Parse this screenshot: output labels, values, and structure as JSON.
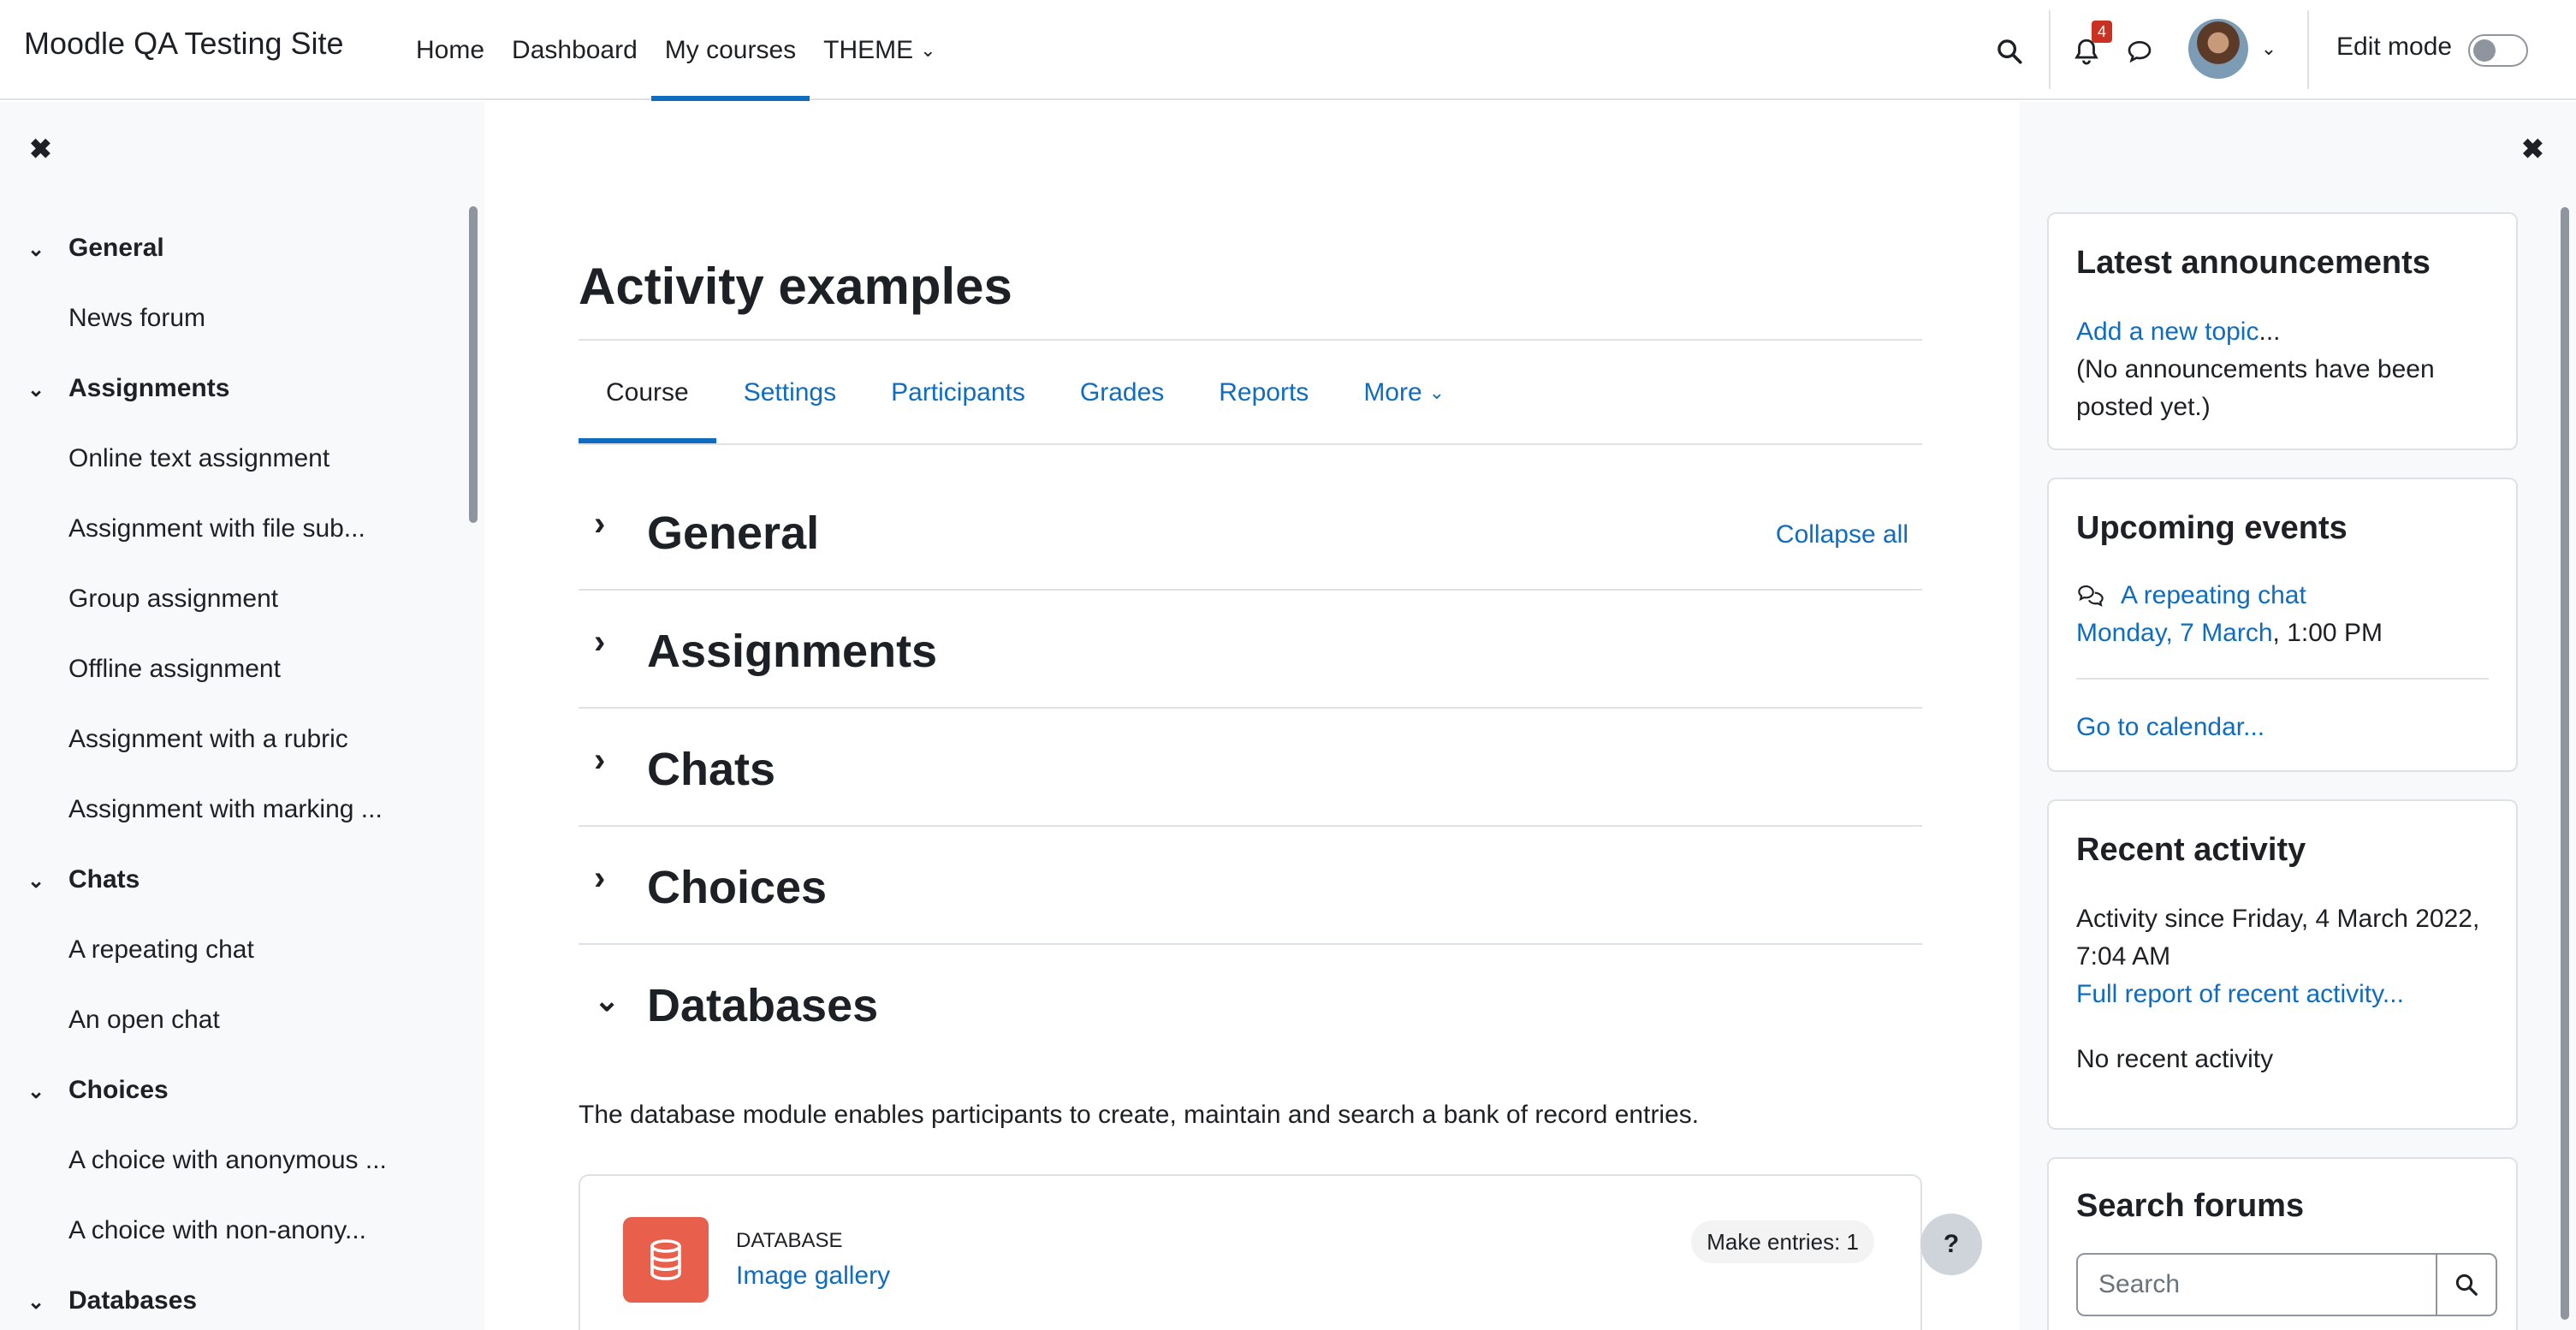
{
  "navbar": {
    "site_name": "Moodle QA Testing Site",
    "items": [
      {
        "label": "Home"
      },
      {
        "label": "Dashboard"
      },
      {
        "label": "My courses"
      },
      {
        "label": "THEME"
      }
    ],
    "active_item": "My courses",
    "notification_count": "4",
    "edit_mode_label": "Edit mode",
    "edit_mode_on": false,
    "icons": [
      "search-icon",
      "bell-icon",
      "chat-bubble-icon",
      "avatar",
      "chevron-down-icon"
    ]
  },
  "course_index": {
    "close_icon": "close-icon",
    "items": [
      {
        "label": "General",
        "type": "section"
      },
      {
        "label": "News forum",
        "type": "activity"
      },
      {
        "label": "Assignments",
        "type": "section"
      },
      {
        "label": "Online text assignment",
        "type": "activity"
      },
      {
        "label": "Assignment with file sub...",
        "type": "activity"
      },
      {
        "label": "Group assignment",
        "type": "activity"
      },
      {
        "label": "Offline assignment",
        "type": "activity"
      },
      {
        "label": "Assignment with a rubric",
        "type": "activity"
      },
      {
        "label": "Assignment with marking ...",
        "type": "activity"
      },
      {
        "label": "Chats",
        "type": "section"
      },
      {
        "label": "A repeating chat",
        "type": "activity"
      },
      {
        "label": "An open chat",
        "type": "activity"
      },
      {
        "label": "Choices",
        "type": "section"
      },
      {
        "label": "A choice with anonymous ...",
        "type": "activity"
      },
      {
        "label": "A choice with non-anony...",
        "type": "activity"
      },
      {
        "label": "Databases",
        "type": "section"
      }
    ]
  },
  "main": {
    "title": "Activity examples",
    "tabs": [
      {
        "label": "Course"
      },
      {
        "label": "Settings"
      },
      {
        "label": "Participants"
      },
      {
        "label": "Grades"
      },
      {
        "label": "Reports"
      },
      {
        "label": "More"
      }
    ],
    "active_tab": "Course",
    "collapse_all": "Collapse all",
    "sections": [
      {
        "title": "General",
        "expanded": false
      },
      {
        "title": "Assignments",
        "expanded": false
      },
      {
        "title": "Chats",
        "expanded": false
      },
      {
        "title": "Choices",
        "expanded": false
      },
      {
        "title": "Databases",
        "expanded": true
      }
    ],
    "databases_summary": "The database module enables participants to create, maintain and search a bank of record entries.",
    "activity": {
      "type": "DATABASE",
      "name": "Image gallery",
      "completion": "Make entries: 1",
      "icon": "database-icon"
    },
    "help_button": "?"
  },
  "blocks": {
    "close_icon": "close-icon",
    "announcements": {
      "title": "Latest announcements",
      "add_link": "Add a new topic",
      "add_suffix": "...",
      "empty": "(No announcements have been posted yet.)"
    },
    "upcoming": {
      "title": "Upcoming events",
      "event_name": "A repeating chat",
      "event_date": "Monday, 7 March",
      "event_time": ", 1:00 PM",
      "calendar_link": "Go to calendar..."
    },
    "recent": {
      "title": "Recent activity",
      "since": "Activity since Friday, 4 March 2022, 7:04 AM",
      "full_report": "Full report of recent activity...",
      "none": "No recent activity"
    },
    "search_forums": {
      "title": "Search forums",
      "placeholder": "Search"
    }
  },
  "colors": {
    "link": "#0f6cbf",
    "drawer_bg": "#f8f9fa",
    "database_icon_bg": "#e8604c",
    "badge": "#ca3120"
  }
}
